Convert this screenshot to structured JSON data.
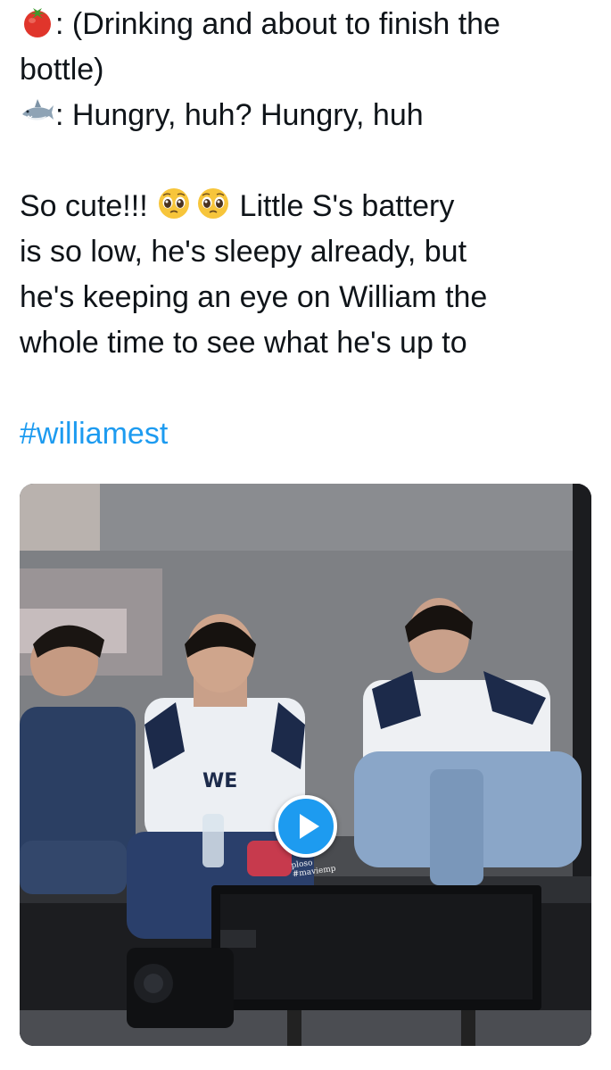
{
  "tweet": {
    "line1_text": ": (Drinking and about to finish the",
    "line2_text": "bottle)",
    "line3_text": ": Hungry, huh? Hungry, huh",
    "line4_pre": "So cute!!! ",
    "line4_post": " Little S's battery",
    "line5_text": "is so low, he's sleepy already, but",
    "line6_text": "he's keeping an eye on William the",
    "line7_text": "whole time to see what he's up to",
    "hashtag": "#williamest",
    "icons": {
      "speaker1": "tomato-emoji",
      "speaker2": "shark-emoji",
      "reaction": "pleading-face-emoji"
    }
  },
  "media": {
    "type": "video",
    "play_icon": "play-icon",
    "watermark": "ploso\n#maviemp",
    "colors": {
      "play_button": "#1d9bf0",
      "hashtag": "#1d9bf0"
    }
  }
}
